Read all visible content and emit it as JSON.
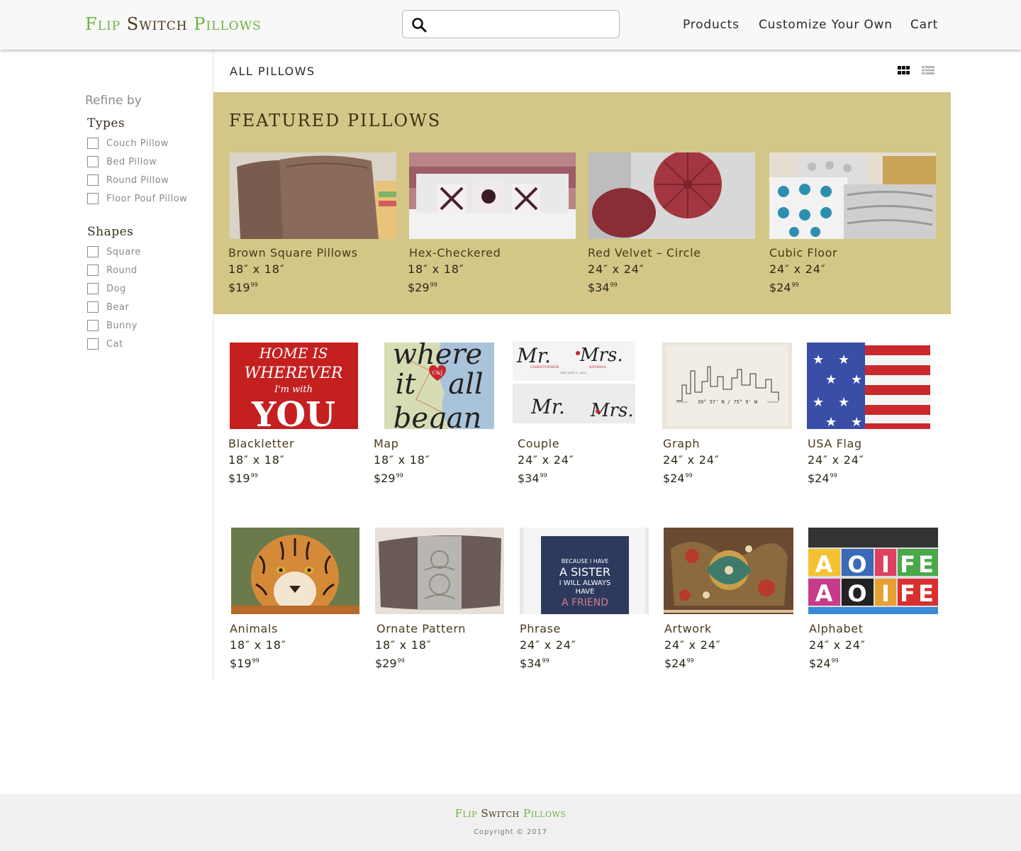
{
  "header": {
    "logo": {
      "w1": "Flip",
      "w2": "Switch",
      "w3": "Pillows"
    },
    "search": {
      "value": "",
      "placeholder": ""
    },
    "nav": [
      "Products",
      "Customize Your Own",
      "Cart"
    ]
  },
  "sidebar": {
    "refine_label": "Refine by",
    "types": {
      "title": "Types",
      "options": [
        "Couch Pillow",
        "Bed Pillow",
        "Round Pillow",
        "Floor Pouf Pillow"
      ]
    },
    "shapes": {
      "title": "Shapes",
      "options": [
        "Square",
        "Round",
        "Dog",
        "Bear",
        "Bunny",
        "Cat"
      ]
    }
  },
  "main": {
    "title": "ALL PILLOWS",
    "view_icons": [
      "grid-view-icon",
      "list-view-icon"
    ],
    "featured": {
      "title": "FEATURED PILLOWS",
      "items": [
        {
          "name": "Brown Square Pillows",
          "size": "18″ x 18″",
          "price": "$19",
          "cents": "99"
        },
        {
          "name": "Hex-Checkered",
          "size": "18″ x 18″",
          "price": "$29",
          "cents": "99"
        },
        {
          "name": "Red Velvet – Circle",
          "size": "24″ x 24″",
          "price": "$34",
          "cents": "99"
        },
        {
          "name": "Cubic Floor",
          "size": "24″ x 24″",
          "price": "$24",
          "cents": "99"
        }
      ]
    },
    "products": [
      {
        "name": "Blackletter",
        "size": "18″ x 18″",
        "price": "$19",
        "cents": "99",
        "thumb_text": [
          "HOME IS",
          "WHEREVER",
          "I'm with",
          "YOU"
        ]
      },
      {
        "name": "Map",
        "size": "18″ x 18″",
        "price": "$29",
        "cents": "99",
        "thumb_text": [
          "where",
          "it",
          "all",
          "began",
          "C&J"
        ]
      },
      {
        "name": "Couple",
        "size": "24″ x 24″",
        "price": "$34",
        "cents": "99",
        "thumb_text": [
          "Mr.",
          "Mrs.",
          "CHRISTOPHER",
          "KATRINA",
          "EST. JULY 3, 2013"
        ]
      },
      {
        "name": "Graph",
        "size": "24″ x 24″",
        "price": "$24",
        "cents": "99",
        "thumb_text": [
          "39° 57' N / 75° 9' W"
        ]
      },
      {
        "name": "USA Flag",
        "size": "24″ x 24″",
        "price": "$24",
        "cents": "99"
      },
      {
        "name": "Animals",
        "size": "18″ x 18″",
        "price": "$19",
        "cents": "99"
      },
      {
        "name": "Ornate Pattern",
        "size": "18″ x 18″",
        "price": "$29",
        "cents": "99"
      },
      {
        "name": "Phrase",
        "size": "24″ x 24″",
        "price": "$34",
        "cents": "99",
        "thumb_text": [
          "BECAUSE I HAVE",
          "A SISTER",
          "I WILL ALWAYS",
          "HAVE",
          "A FRIEND"
        ]
      },
      {
        "name": "Artwork",
        "size": "24″ x 24″",
        "price": "$24",
        "cents": "99"
      },
      {
        "name": "Alphabet",
        "size": "24″ x 24″",
        "price": "$24",
        "cents": "99",
        "thumb_text": [
          "A",
          "O",
          "I",
          "F",
          "E"
        ]
      }
    ]
  },
  "footer": {
    "logo": {
      "w1": "Flip",
      "w2": "Switch",
      "w3": "Pillows"
    },
    "copyright": "Copyright © 2017"
  },
  "colors": {
    "accent_green": "#6cb33f",
    "brand_brown": "#4a3a18",
    "featured_bg": "#d4c687"
  }
}
